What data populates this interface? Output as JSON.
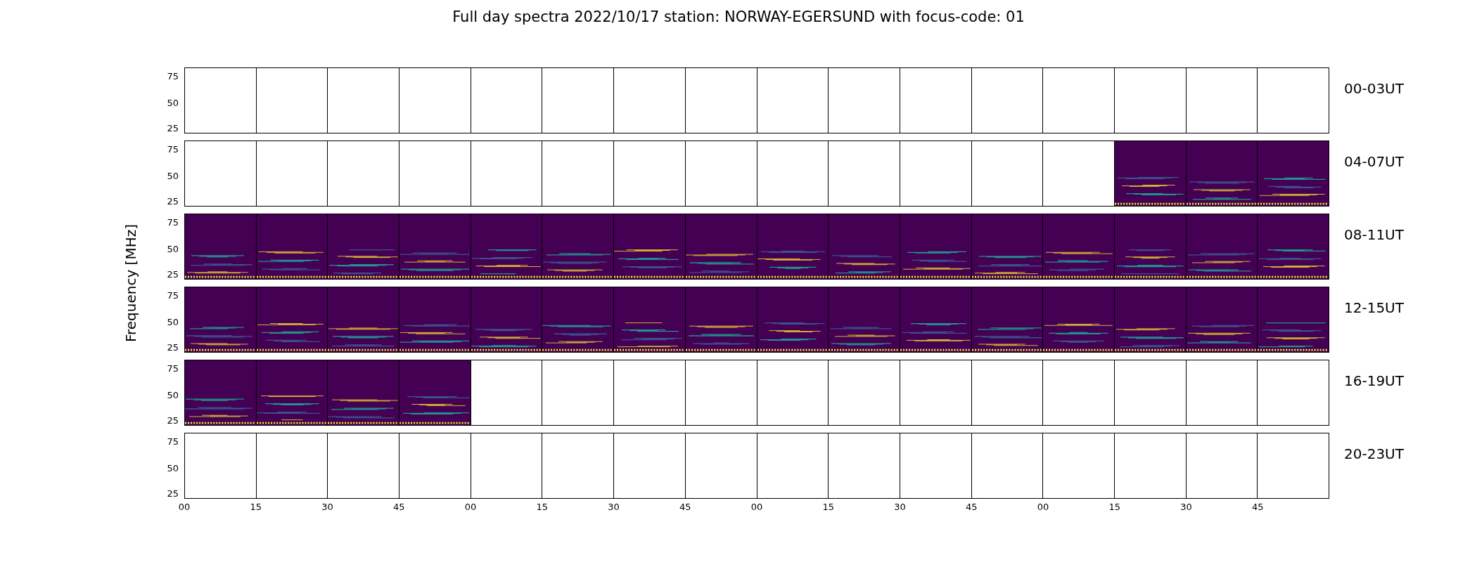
{
  "title": "Full day spectra 2022/10/17 station: NORWAY-EGERSUND with focus-code: 01",
  "y_axis_label": "Frequency [MHz]",
  "rows": [
    {
      "label": "00-03UT",
      "yticks": [
        "75",
        "50",
        "25"
      ],
      "panels": [
        {
          "has_data": false
        },
        {
          "has_data": false
        },
        {
          "has_data": false
        },
        {
          "has_data": false
        },
        {
          "has_data": false
        },
        {
          "has_data": false
        },
        {
          "has_data": false
        },
        {
          "has_data": false
        },
        {
          "has_data": false
        },
        {
          "has_data": false
        },
        {
          "has_data": false
        },
        {
          "has_data": false
        },
        {
          "has_data": false
        },
        {
          "has_data": false
        },
        {
          "has_data": false
        },
        {
          "has_data": false
        }
      ]
    },
    {
      "label": "04-07UT",
      "yticks": [
        "75",
        "50",
        "25"
      ],
      "panels": [
        {
          "has_data": false
        },
        {
          "has_data": false
        },
        {
          "has_data": false
        },
        {
          "has_data": false
        },
        {
          "has_data": false
        },
        {
          "has_data": false
        },
        {
          "has_data": false
        },
        {
          "has_data": false
        },
        {
          "has_data": false
        },
        {
          "has_data": false
        },
        {
          "has_data": false
        },
        {
          "has_data": false
        },
        {
          "has_data": false
        },
        {
          "has_data": true
        },
        {
          "has_data": true
        },
        {
          "has_data": true
        }
      ]
    },
    {
      "label": "08-11UT",
      "yticks": [
        "75",
        "50",
        "25"
      ],
      "panels": [
        {
          "has_data": true
        },
        {
          "has_data": true
        },
        {
          "has_data": true
        },
        {
          "has_data": true
        },
        {
          "has_data": true
        },
        {
          "has_data": true
        },
        {
          "has_data": true
        },
        {
          "has_data": true
        },
        {
          "has_data": true
        },
        {
          "has_data": true
        },
        {
          "has_data": true
        },
        {
          "has_data": true
        },
        {
          "has_data": true
        },
        {
          "has_data": true
        },
        {
          "has_data": true
        },
        {
          "has_data": true
        }
      ]
    },
    {
      "label": "12-15UT",
      "yticks": [
        "75",
        "50",
        "25"
      ],
      "panels": [
        {
          "has_data": true
        },
        {
          "has_data": true
        },
        {
          "has_data": true
        },
        {
          "has_data": true
        },
        {
          "has_data": true
        },
        {
          "has_data": true
        },
        {
          "has_data": true
        },
        {
          "has_data": true
        },
        {
          "has_data": true
        },
        {
          "has_data": true
        },
        {
          "has_data": true
        },
        {
          "has_data": true
        },
        {
          "has_data": true
        },
        {
          "has_data": true
        },
        {
          "has_data": true
        },
        {
          "has_data": true
        }
      ]
    },
    {
      "label": "16-19UT",
      "yticks": [
        "75",
        "50",
        "25"
      ],
      "panels": [
        {
          "has_data": true
        },
        {
          "has_data": true
        },
        {
          "has_data": true
        },
        {
          "has_data": true
        },
        {
          "has_data": false
        },
        {
          "has_data": false
        },
        {
          "has_data": false
        },
        {
          "has_data": false
        },
        {
          "has_data": false
        },
        {
          "has_data": false
        },
        {
          "has_data": false
        },
        {
          "has_data": false
        },
        {
          "has_data": false
        },
        {
          "has_data": false
        },
        {
          "has_data": false
        },
        {
          "has_data": false
        }
      ]
    },
    {
      "label": "20-23UT",
      "yticks": [
        "75",
        "50",
        "25"
      ],
      "panels": [
        {
          "has_data": false
        },
        {
          "has_data": false
        },
        {
          "has_data": false
        },
        {
          "has_data": false
        },
        {
          "has_data": false
        },
        {
          "has_data": false
        },
        {
          "has_data": false
        },
        {
          "has_data": false
        },
        {
          "has_data": false
        },
        {
          "has_data": false
        },
        {
          "has_data": false
        },
        {
          "has_data": false
        },
        {
          "has_data": false
        },
        {
          "has_data": false
        },
        {
          "has_data": false
        },
        {
          "has_data": false
        }
      ]
    }
  ],
  "x_ticks": [
    "00",
    "15",
    "30",
    "45",
    "00",
    "15",
    "30",
    "45",
    "00",
    "15",
    "30",
    "45",
    "00",
    "15",
    "30",
    "45"
  ]
}
